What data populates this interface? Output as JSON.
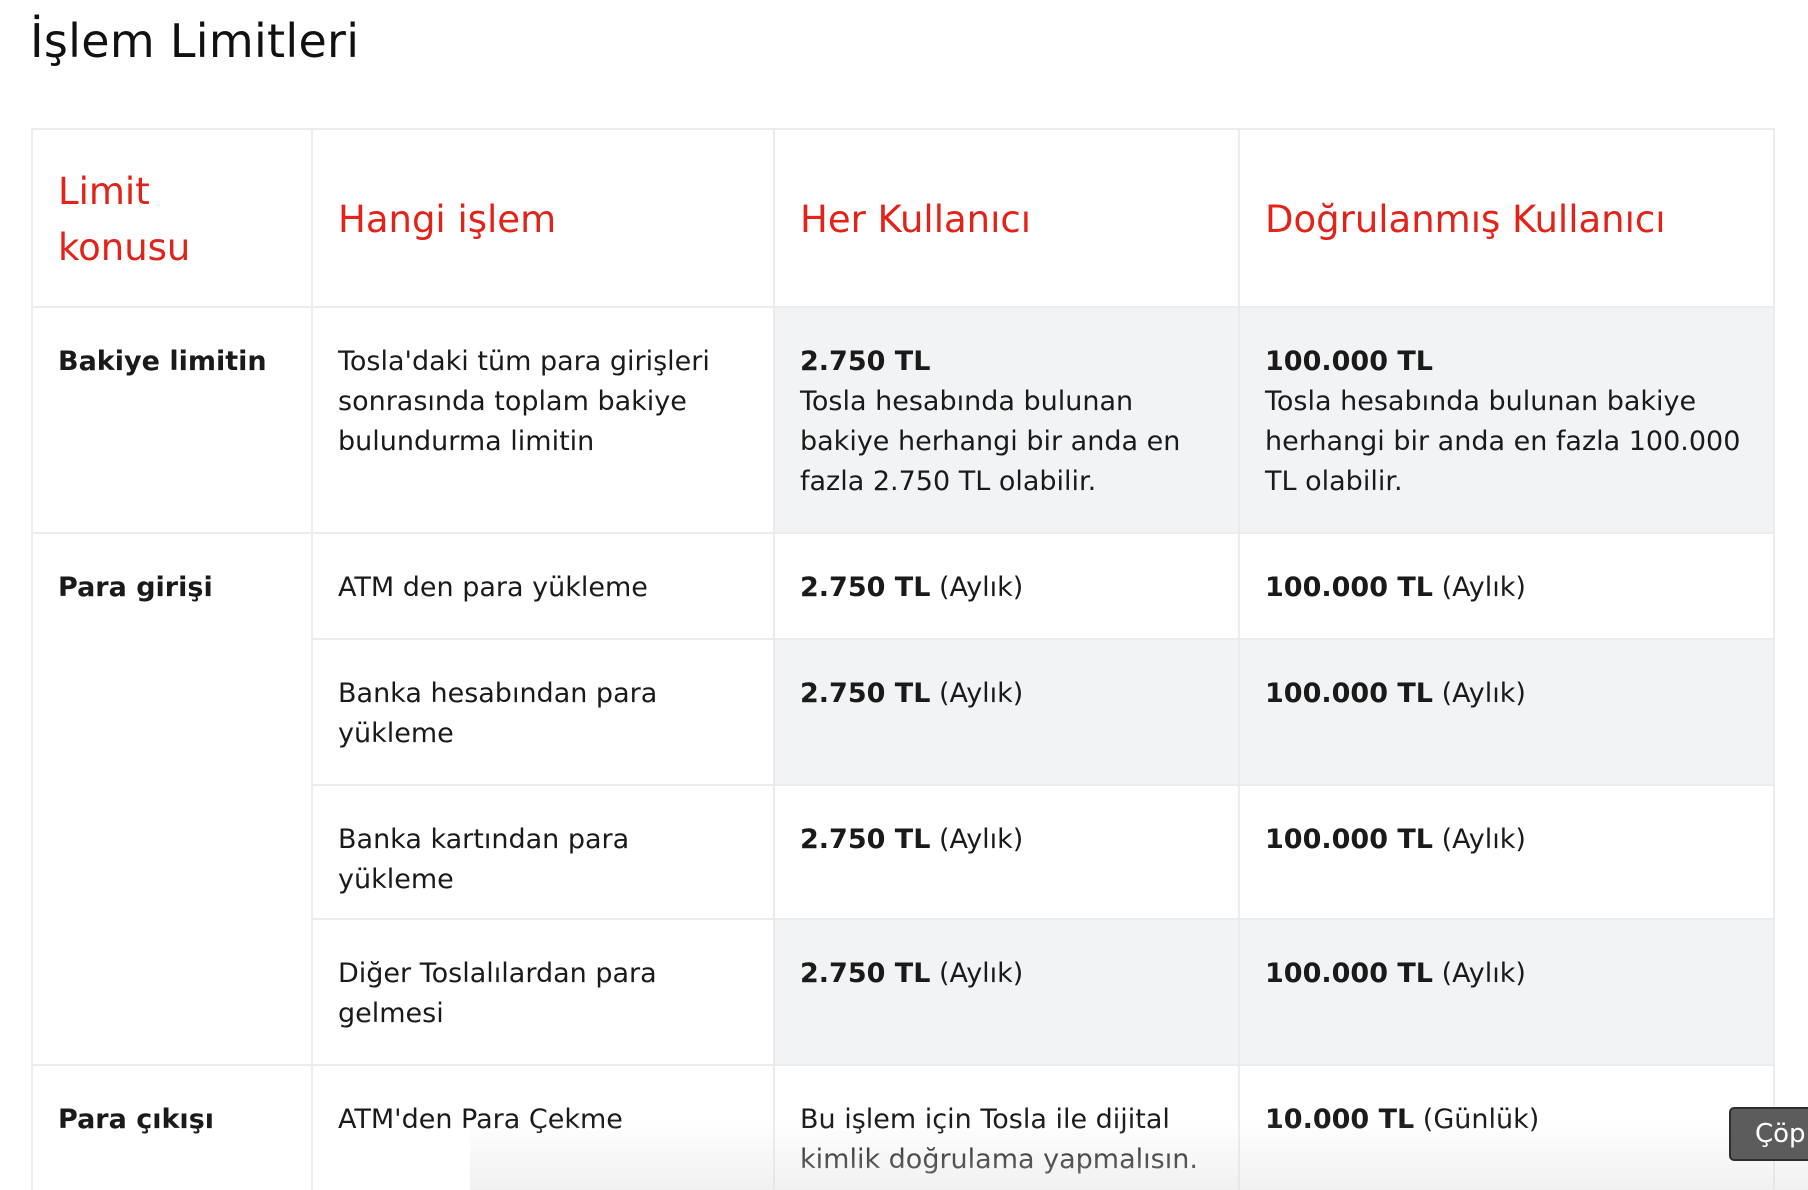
{
  "page": {
    "title": "İşlem Limitleri"
  },
  "table": {
    "headers": {
      "topic": "Limit konusu",
      "operation": "Hangi işlem",
      "every_user": "Her Kullanıcı",
      "verified_user": "Doğrulanmış Kullanıcı"
    },
    "rows": [
      {
        "topic": "Bakiye limitin",
        "operation": "Tosla'daki tüm para girişleri sonrasında toplam bakiye bulundurma limitin",
        "every_user": {
          "value": "2.750 TL",
          "note": "Tosla hesabında bulunan bakiye herhangi bir anda en fazla 2.750 TL olabilir."
        },
        "verified_user": {
          "value": "100.000 TL",
          "note": "Tosla hesabında bulunan bakiye herhangi bir anda en fazla 100.000 TL olabilir."
        }
      },
      {
        "topic": "Para girişi",
        "operation": "ATM den para yükleme",
        "every_user": {
          "value": "2.750 TL",
          "period": " (Aylık)"
        },
        "verified_user": {
          "value": "100.000 TL",
          "period": " (Aylık)"
        }
      },
      {
        "operation": "Banka hesabından para yükleme",
        "every_user": {
          "value": "2.750 TL",
          "period": " (Aylık)"
        },
        "verified_user": {
          "value": "100.000 TL",
          "period": " (Aylık)"
        }
      },
      {
        "operation": "Banka kartından para yükleme",
        "every_user": {
          "value": "2.750 TL",
          "period": " (Aylık)"
        },
        "verified_user": {
          "value": "100.000 TL",
          "period": " (Aylık)"
        }
      },
      {
        "operation": "Diğer Toslalılardan para gelmesi",
        "every_user": {
          "value": "2.750 TL",
          "period": " (Aylık)"
        },
        "verified_user": {
          "value": "100.000 TL",
          "period": " (Aylık)"
        }
      },
      {
        "topic": "Para çıkışı",
        "operation": "ATM'den Para Çekme",
        "every_user": {
          "note": "Bu işlem için Tosla ile dijital kimlik doğrulama yapmalısın."
        },
        "verified_user": {
          "value": "10.000 TL",
          "period": " (Günlük)"
        }
      }
    ]
  },
  "copy_button": {
    "label": "Çöp"
  },
  "colors": {
    "header_red": "#e2231a",
    "shaded_cell": "#f2f3f5",
    "border": "#ececec"
  }
}
